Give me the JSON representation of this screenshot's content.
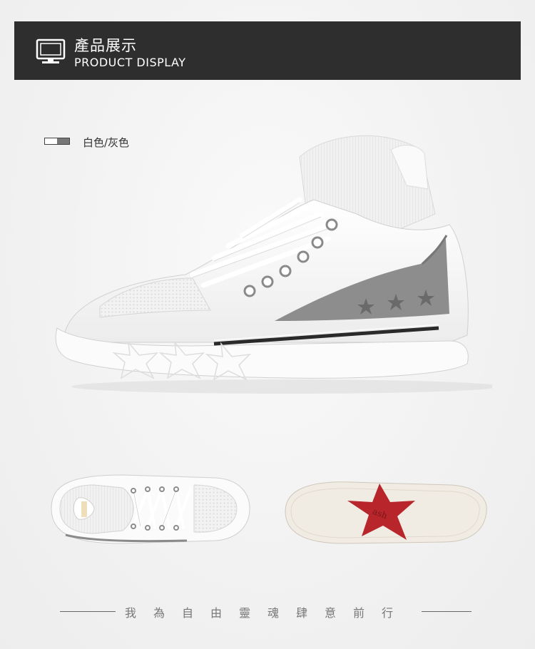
{
  "header": {
    "title": "產品展示",
    "subtitle": "PRODUCT DISPLAY",
    "icon": "monitor-icon"
  },
  "product": {
    "color_label": "白色/灰色",
    "swatch_colors": [
      "#ffffff",
      "#777777"
    ],
    "images": {
      "main": "side-view-sneaker",
      "top": "top-view-sneaker",
      "sole": "sole-view-sneaker"
    }
  },
  "footer": {
    "slogan": "我為自由靈魂肆意前行"
  },
  "colors": {
    "header_bg": "#2e2e2e",
    "accent_gray": "#8a8a8a",
    "sole_star_red": "#b8262c"
  }
}
